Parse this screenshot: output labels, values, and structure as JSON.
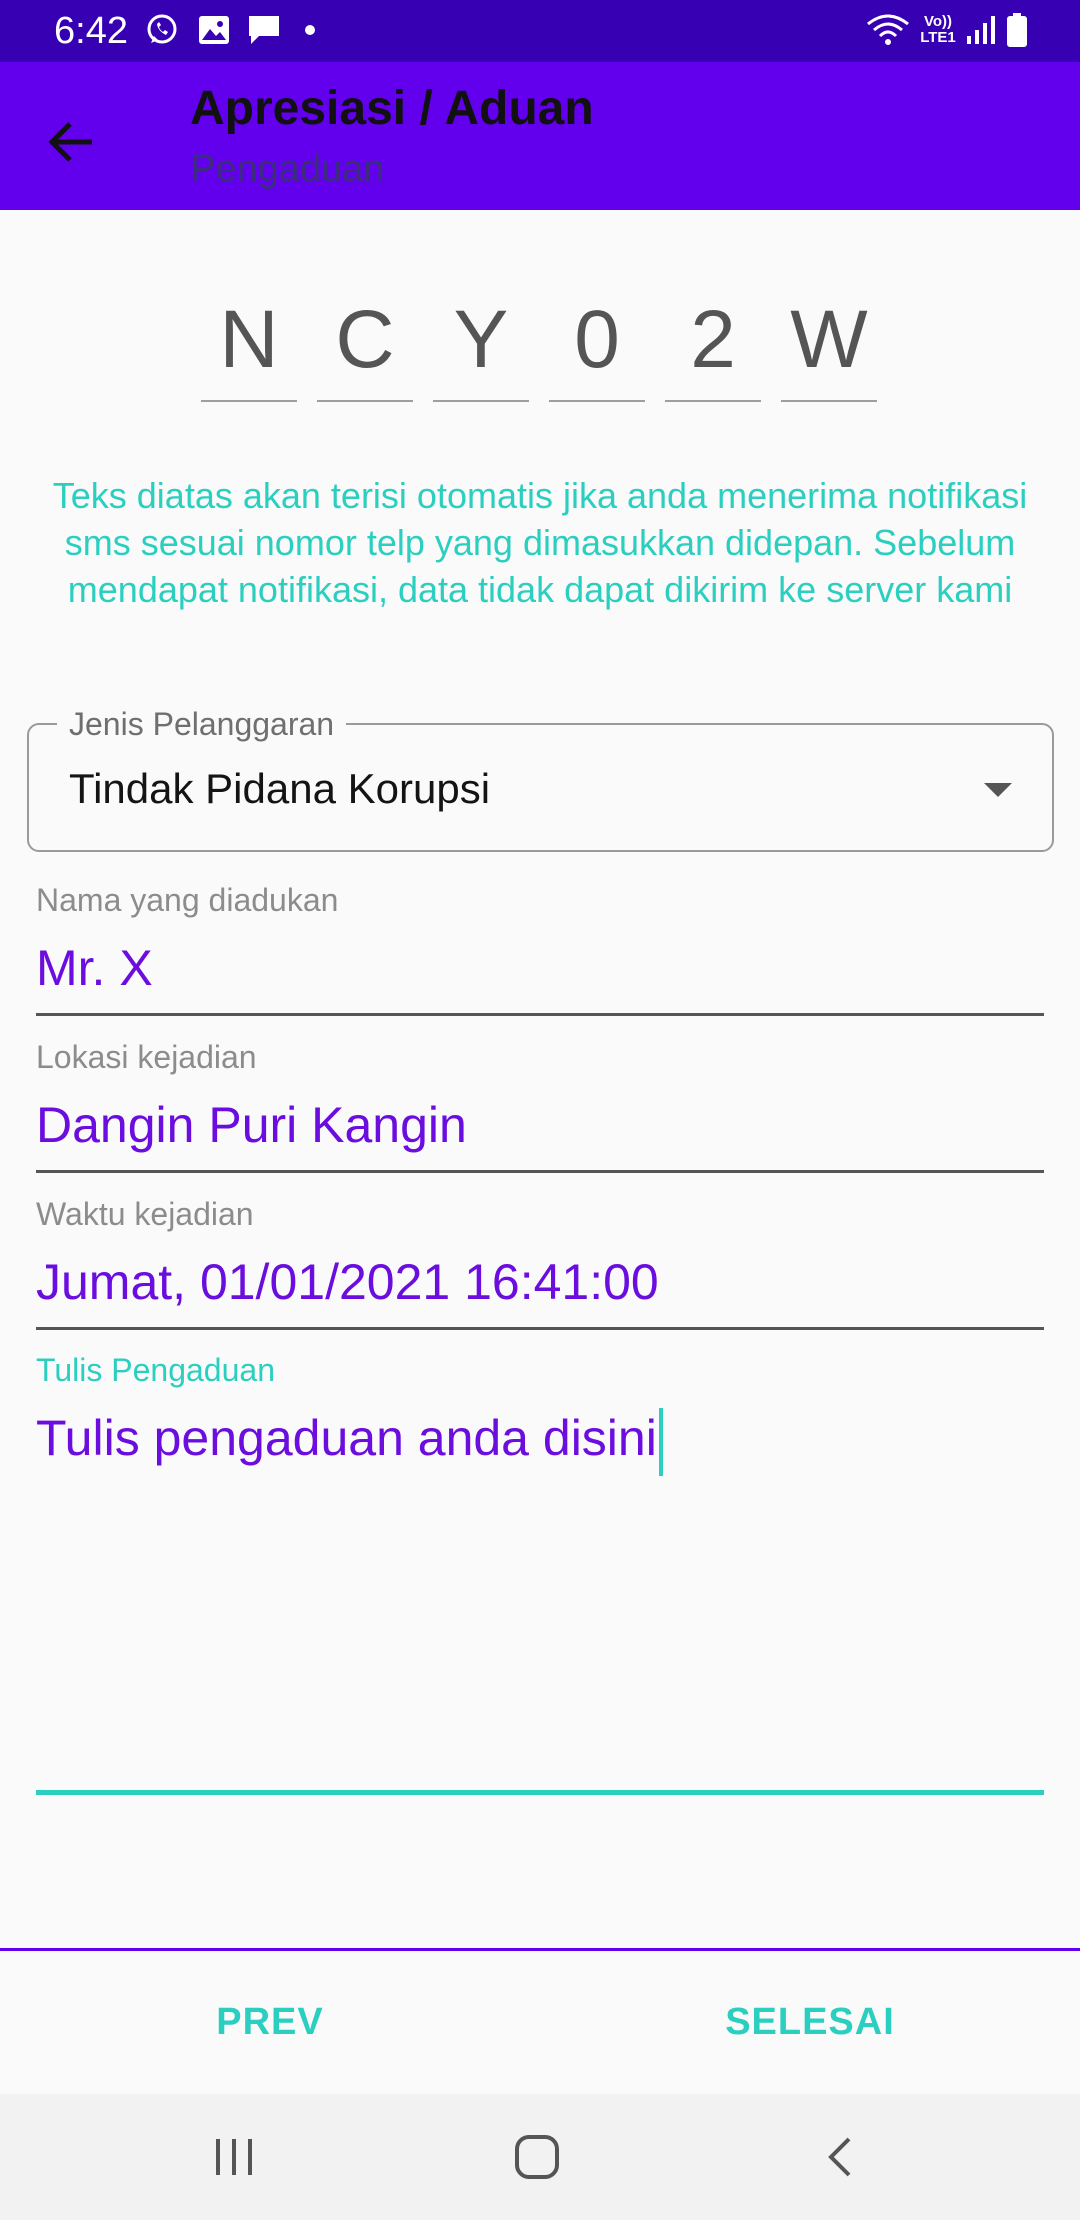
{
  "status_bar": {
    "time": "6:42",
    "network_label": "Vo)) LTE1",
    "icons": [
      "whatsapp-icon",
      "image-icon",
      "chat-icon",
      "dot-icon",
      "wifi-icon",
      "volte-icon",
      "signal-icon",
      "battery-icon"
    ]
  },
  "app_bar": {
    "title": "Apresiasi / Aduan",
    "subtitle": "Pengaduan"
  },
  "code": [
    "N",
    "C",
    "Y",
    "0",
    "2",
    "W"
  ],
  "info_text": "Teks diatas akan terisi otomatis jika anda menerima notifikasi sms sesuai nomor telp yang dimasukkan didepan. Sebelum mendapat notifikasi, data tidak dapat dikirim ke server kami",
  "violation_type": {
    "label": "Jenis Pelanggaran",
    "value": "Tindak Pidana Korupsi"
  },
  "fields": {
    "reported_name": {
      "label": "Nama yang diadukan",
      "value": "Mr. X"
    },
    "location": {
      "label": "Lokasi kejadian",
      "value": "Dangin Puri Kangin"
    },
    "time": {
      "label": "Waktu kejadian",
      "value": "Jumat, 01/01/2021 16:41:00"
    },
    "complaint": {
      "label": "Tulis Pengaduan",
      "value": "Tulis pengaduan anda disini"
    }
  },
  "buttons": {
    "prev": "PREV",
    "finish": "SELESAI"
  },
  "colors": {
    "status_bar": "#3700b3",
    "app_bar": "#6200ee",
    "accent_teal": "#2bcfc0",
    "value_purple": "#6a0dde"
  }
}
